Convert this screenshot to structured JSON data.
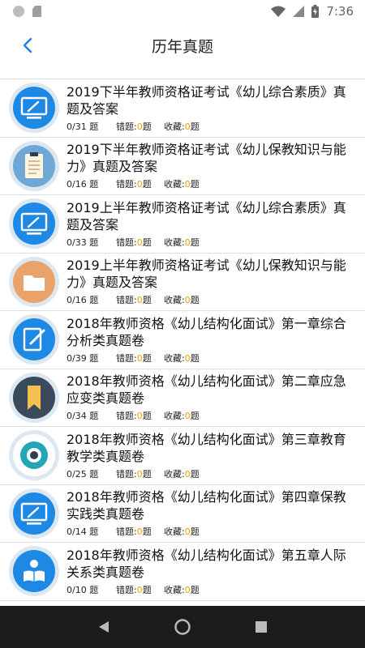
{
  "status_bar": {
    "time": "7:36"
  },
  "header": {
    "title": "历年真题",
    "back_icon": "chevron-left-icon"
  },
  "colors": {
    "accent": "#1e88e5",
    "highlight": "#f0a000",
    "nav_bg": "#1c1c1c"
  },
  "items": [
    {
      "title": "2019下半年教师资格证考试《幼儿综合素质》真题及答案",
      "count": "0/31 题",
      "wrong_label": "错题:",
      "wrong": "0",
      "wrong_suffix": "题",
      "fav_label": "收藏:",
      "fav": "0",
      "fav_suffix": "题",
      "icon": "monitor-icon"
    },
    {
      "title": "2019下半年教师资格证考试《幼儿保教知识与能力》真题及答案",
      "count": "0/16 题",
      "wrong_label": "错题:",
      "wrong": "0",
      "wrong_suffix": "题",
      "fav_label": "收藏:",
      "fav": "0",
      "fav_suffix": "题",
      "icon": "clipboard-icon"
    },
    {
      "title": "2019上半年教师资格证考试《幼儿综合素质》真题及答案",
      "count": "0/33 题",
      "wrong_label": "错题:",
      "wrong": "0",
      "wrong_suffix": "题",
      "fav_label": "收藏:",
      "fav": "0",
      "fav_suffix": "题",
      "icon": "monitor-icon"
    },
    {
      "title": "2019上半年教师资格证考试《幼儿保教知识与能力》真题及答案",
      "count": "0/16 题",
      "wrong_label": "错题:",
      "wrong": "0",
      "wrong_suffix": "题",
      "fav_label": "收藏:",
      "fav": "0",
      "fav_suffix": "题",
      "icon": "folder-icon"
    },
    {
      "title": "2018年教师资格《幼儿结构化面试》第一章综合分析类真题卷",
      "count": "0/39 题",
      "wrong_label": "错题:",
      "wrong": "0",
      "wrong_suffix": "题",
      "fav_label": "收藏:",
      "fav": "0",
      "fav_suffix": "题",
      "icon": "edit-icon"
    },
    {
      "title": "2018年教师资格《幼儿结构化面试》第二章应急应变类真题卷",
      "count": "0/34 题",
      "wrong_label": "错题:",
      "wrong": "0",
      "wrong_suffix": "题",
      "fav_label": "收藏:",
      "fav": "0",
      "fav_suffix": "题",
      "icon": "bookmark-icon"
    },
    {
      "title": "2018年教师资格《幼儿结构化面试》第三章教育教学类真题卷",
      "count": "0/25 题",
      "wrong_label": "错题:",
      "wrong": "0",
      "wrong_suffix": "题",
      "fav_label": "收藏:",
      "fav": "0",
      "fav_suffix": "题",
      "icon": "eye-icon"
    },
    {
      "title": "2018年教师资格《幼儿结构化面试》第四章保教实践类真题卷",
      "count": "0/14 题",
      "wrong_label": "错题:",
      "wrong": "0",
      "wrong_suffix": "题",
      "fav_label": "收藏:",
      "fav": "0",
      "fav_suffix": "题",
      "icon": "monitor-icon"
    },
    {
      "title": "2018年教师资格《幼儿结构化面试》第五章人际关系类真题卷",
      "count": "0/10 题",
      "wrong_label": "错题:",
      "wrong": "0",
      "wrong_suffix": "题",
      "fav_label": "收藏:",
      "fav": "0",
      "fav_suffix": "题",
      "icon": "reader-icon"
    }
  ]
}
